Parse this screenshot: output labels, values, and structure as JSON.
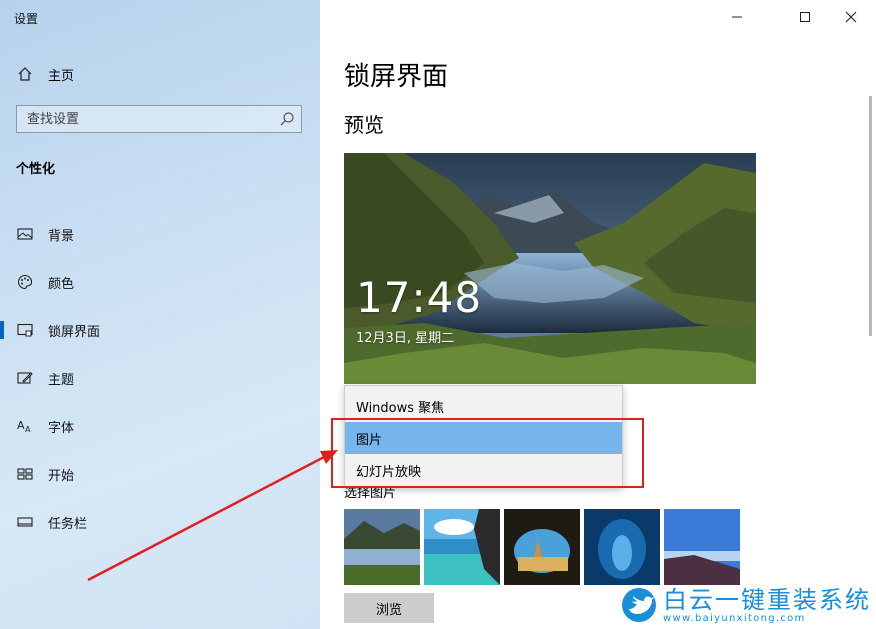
{
  "window": {
    "title": "设置"
  },
  "sidebar": {
    "home_label": "主页",
    "search_placeholder": "查找设置",
    "section_header": "个性化",
    "items": [
      {
        "label": "背景",
        "icon": "picture-icon"
      },
      {
        "label": "颜色",
        "icon": "palette-icon"
      },
      {
        "label": "锁屏界面",
        "icon": "lockscreen-icon",
        "active": true
      },
      {
        "label": "主题",
        "icon": "theme-icon"
      },
      {
        "label": "字体",
        "icon": "font-icon"
      },
      {
        "label": "开始",
        "icon": "start-icon"
      },
      {
        "label": "任务栏",
        "icon": "taskbar-icon"
      }
    ]
  },
  "main": {
    "title": "锁屏界面",
    "preview_heading": "预览",
    "preview_time": "17:48",
    "preview_date": "12月3日, 星期二",
    "background_label": "选择图片",
    "browse_label": "浏览",
    "thumbnails": [
      "lake-mountains",
      "beach-rock",
      "sea-cave",
      "ice-cave",
      "night-coast"
    ]
  },
  "dropdown": {
    "options": [
      "Windows 聚焦",
      "图片",
      "幻灯片放映"
    ],
    "selected": "图片"
  },
  "watermark": {
    "name": "白云一键重装系统",
    "url": "www.baiyunxitong.com"
  },
  "colors": {
    "accent": "#0067c0",
    "selected_option": "#76b5ea",
    "annotation": "#e02020",
    "watermark": "#1a8fd8"
  }
}
